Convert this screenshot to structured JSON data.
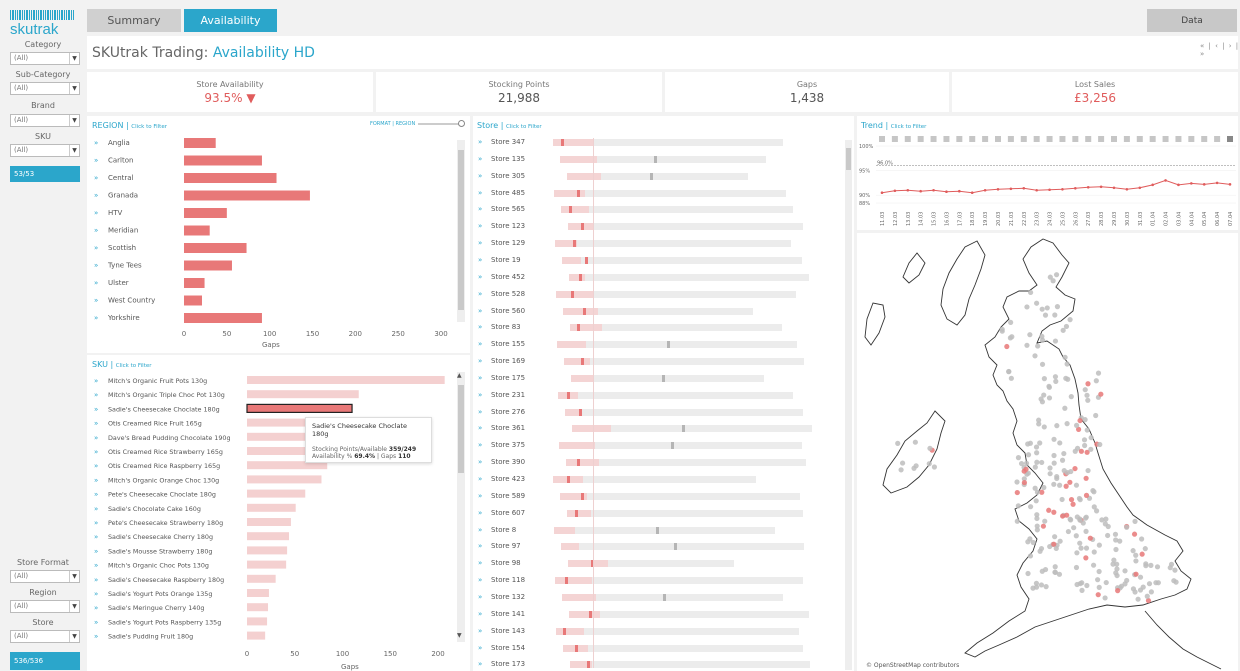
{
  "tabs": [
    {
      "label": "Summary",
      "active": false
    },
    {
      "label": "Availability",
      "active": true
    }
  ],
  "data_button": "Data",
  "logo_text": "skutrak",
  "header": {
    "title_prefix": "SKUtrak Trading: ",
    "title_highlight": "Availability HD",
    "mini_nav": "« | ‹ | › | »"
  },
  "filters": {
    "category": {
      "label": "Category",
      "value": "(All)"
    },
    "subcategory": {
      "label": "Sub-Category",
      "value": "(All)"
    },
    "brand": {
      "label": "Brand",
      "value": "(All)"
    },
    "sku": {
      "label": "SKU",
      "value": "(All)"
    },
    "sku_count": "53/53",
    "store_format": {
      "label": "Store Format",
      "value": "(All)"
    },
    "region": {
      "label": "Region",
      "value": "(All)"
    },
    "store": {
      "label": "Store",
      "value": "(All)"
    },
    "store_count": "536/536"
  },
  "kpis": {
    "availability": {
      "label": "Store Availability",
      "value": "93.5%",
      "trend": "down"
    },
    "stocking": {
      "label": "Stocking Points",
      "value": "21,988"
    },
    "gaps": {
      "label": "Gaps",
      "value": "1,438"
    },
    "lost_sales": {
      "label": "Lost Sales",
      "value": "£3,256"
    }
  },
  "region_panel": {
    "title": "REGION | ",
    "click": "Click to Filter",
    "toggle": "FORMAT | REGION",
    "xlabel": "Gaps"
  },
  "sku_panel": {
    "title": "SKU | ",
    "click": "Click to Filter",
    "xlabel": "Gaps"
  },
  "store_panel": {
    "title": "Store | ",
    "click": "Click to Filter"
  },
  "trend_panel": {
    "title": "Trend | ",
    "click": "Click to Filter"
  },
  "chart_data": [
    {
      "type": "bar",
      "title": "REGION",
      "xlabel": "Gaps",
      "xlim": [
        0,
        300
      ],
      "xticks": [
        0,
        50,
        100,
        150,
        200,
        250,
        300
      ],
      "categories": [
        "Anglia",
        "Carlton",
        "Central",
        "Granada",
        "HTV",
        "Meridian",
        "Scottish",
        "Tyne Tees",
        "Ulster",
        "West Country",
        "Yorkshire"
      ],
      "values": [
        37,
        91,
        108,
        147,
        50,
        30,
        73,
        56,
        24,
        21,
        91
      ]
    },
    {
      "type": "bar",
      "title": "SKU",
      "xlabel": "Gaps",
      "xlim": [
        0,
        200
      ],
      "xticks": [
        0,
        50,
        100,
        150,
        200
      ],
      "categories": [
        "Mitch's Organic Fruit Pots 130g",
        "Mitch's Organic Triple Choc Pot 130g",
        "Sadie's Cheesecake Choclate 180g",
        "Otis Creamed Rice Fruit 165g",
        "Dave's Bread Pudding Chocolate 190g",
        "Otis Creamed Rice Strawberry 165g",
        "Otis Creamed Rice Raspberry 165g",
        "Mitch's Organic Orange Choc 130g",
        "Pete's Cheesecake Choclate 180g",
        "Sadie's Chocolate Cake 160g",
        "Pete's Cheesecake Strawberry 180g",
        "Sadie's Cheesecake Cherry 180g",
        "Sadie's Mousse Strawberry 180g",
        "Mitch's Organic Choc Pots 130g",
        "Sadie's Cheesecake Raspberry 180g",
        "Sadie's Yogurt Pots Orange 135g",
        "Sadie's Meringue Cherry 140g",
        "Sadie's Yogurt Pots Raspberry 135g",
        "Sadie's Pudding Fruit 180g"
      ],
      "values": [
        207,
        117,
        110,
        100,
        97,
        95,
        84,
        78,
        61,
        51,
        46,
        44,
        42,
        41,
        30,
        23,
        22,
        21,
        19
      ]
    },
    {
      "type": "bar",
      "title": "Store",
      "categories": [
        "Store 347",
        "Store 135",
        "Store 305",
        "Store 485",
        "Store 565",
        "Store 123",
        "Store 129",
        "Store 19",
        "Store 452",
        "Store 528",
        "Store 560",
        "Store 83",
        "Store 155",
        "Store 169",
        "Store 175",
        "Store 231",
        "Store 276",
        "Store 361",
        "Store 375",
        "Store 390",
        "Store 423",
        "Store 589",
        "Store 607",
        "Store 8",
        "Store 97",
        "Store 98",
        "Store 118",
        "Store 132",
        "Store 141",
        "Store 143",
        "Store 154",
        "Store 173"
      ],
      "series": [
        {
          "name": "Stocking Points",
          "values": [
            230,
            206,
            181,
            232,
            232,
            235,
            236,
            240,
            240,
            240,
            190,
            212,
            240,
            240,
            193,
            235,
            238,
            240,
            243,
            240,
            203,
            240,
            236,
            221,
            243,
            166,
            248,
            221,
            240,
            243,
            240,
            240
          ]
        },
        {
          "name": "Gaps",
          "values": [
            4,
            3,
            2,
            4,
            3,
            3,
            3,
            3,
            3,
            3,
            3,
            3,
            2,
            3,
            2,
            3,
            3,
            2,
            2,
            3,
            2,
            3,
            3,
            2,
            2,
            3,
            3,
            2,
            3,
            3,
            3,
            3
          ]
        }
      ]
    },
    {
      "type": "line",
      "title": "Trend",
      "ylim": [
        88,
        100
      ],
      "yticks": [
        "100%",
        "95%",
        "90%",
        "88%"
      ],
      "reference": "96.0%",
      "x": [
        "11.03",
        "12.03",
        "13.03",
        "14.03",
        "15.03",
        "16.03",
        "17.03",
        "18.03",
        "19.03",
        "20.03",
        "21.03",
        "22.03",
        "23.03",
        "24.03",
        "25.03",
        "26.03",
        "27.03",
        "28.03",
        "29.03",
        "30.03",
        "31.03",
        "01.04",
        "02.04",
        "03.04",
        "04.04",
        "05.04",
        "06.04",
        "07.04"
      ],
      "series": [
        {
          "values": [
            90.5,
            90.9,
            91.0,
            90.8,
            91.0,
            90.7,
            90.8,
            90.5,
            91.0,
            91.2,
            91.3,
            91.4,
            91.0,
            91.1,
            91.2,
            91.4,
            91.6,
            91.7,
            91.5,
            91.2,
            91.5,
            92.1,
            93.0,
            92.1,
            92.4,
            92.2,
            92.5,
            92.2
          ]
        }
      ]
    }
  ],
  "tooltip": {
    "title": "Sadie's Cheesecake Choclate 180g",
    "line1_label": "Stocking Points/Available ",
    "line1_value": "359/249",
    "line2_label": "Availability % ",
    "line2_value": "69.4%",
    "line2_sep": " | Gaps ",
    "line2_gaps": "110"
  },
  "map_credit": "© OpenStreetMap contributors",
  "colors": {
    "accent": "#2ba6cb",
    "bar": "#e87878",
    "bar_light": "#f4d0d0",
    "grey": "#b5b5b5"
  }
}
